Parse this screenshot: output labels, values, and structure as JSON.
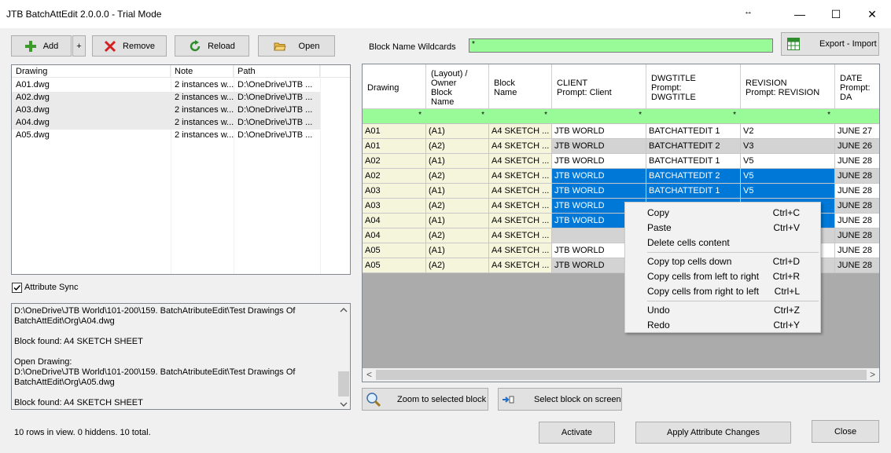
{
  "window": {
    "title": "JTB BatchAttEdit 2.0.0.0 - Trial Mode",
    "resize_glyph": "↔",
    "minimize": "—",
    "maximize": "☐",
    "close": "✕"
  },
  "toolbar": {
    "add": "Add",
    "plus": "+",
    "remove": "Remove",
    "reload": "Reload",
    "open": "Open"
  },
  "wildcards": {
    "label": "Block Name Wildcards",
    "value": "*"
  },
  "export_import": "Export - Import",
  "drawings": {
    "columns": [
      "Drawing",
      "Note",
      "Path"
    ],
    "rows": [
      {
        "drawing": "A01.dwg",
        "note": "2 instances w...",
        "path": "D:\\OneDrive\\JTB ..."
      },
      {
        "drawing": "A02.dwg",
        "note": "2 instances w...",
        "path": "D:\\OneDrive\\JTB ..."
      },
      {
        "drawing": "A03.dwg",
        "note": "2 instances w...",
        "path": "D:\\OneDrive\\JTB ..."
      },
      {
        "drawing": "A04.dwg",
        "note": "2 instances w...",
        "path": "D:\\OneDrive\\JTB ..."
      },
      {
        "drawing": "A05.dwg",
        "note": "2 instances w...",
        "path": "D:\\OneDrive\\JTB ..."
      }
    ]
  },
  "attribute_sync": {
    "label": "Attribute Sync",
    "checked": true
  },
  "log": "D:\\OneDrive\\JTB World\\101-200\\159. BatchAtributeEdit\\Test Drawings Of BatchAttEdit\\Org\\A04.dwg\n\nBlock found: A4 SKETCH SHEET\n\nOpen Drawing:\nD:\\OneDrive\\JTB World\\101-200\\159. BatchAtributeEdit\\Test Drawings Of BatchAttEdit\\Org\\A05.dwg\n\nBlock found: A4 SKETCH SHEET",
  "grid": {
    "headers": [
      "Drawing",
      "(Layout) /\nOwner\nBlock\nName",
      "Block\nName",
      "CLIENT\nPrompt: Client",
      "DWGTITLE\nPrompt:\nDWGTITLE",
      "REVISION\nPrompt: REVISION",
      "DATE\nPrompt: DA"
    ],
    "filter": [
      "*",
      "*",
      "*",
      "*",
      "*",
      "*",
      ""
    ],
    "rows": [
      [
        "A01",
        "(A1)",
        "A4 SKETCH ...",
        "JTB WORLD",
        "BATCHATTEDIT 1",
        "V2",
        "JUNE 27"
      ],
      [
        "A01",
        "(A2)",
        "A4 SKETCH ...",
        "JTB WORLD",
        "BATCHATTEDIT 2",
        "V3",
        "JUNE 26"
      ],
      [
        "A02",
        "(A1)",
        "A4 SKETCH ...",
        "JTB WORLD",
        "BATCHATTEDIT 1",
        "V5",
        "JUNE 28"
      ],
      [
        "A02",
        "(A2)",
        "A4 SKETCH ...",
        "JTB WORLD",
        "BATCHATTEDIT 2",
        "V5",
        "JUNE 28"
      ],
      [
        "A03",
        "(A1)",
        "A4 SKETCH ...",
        "JTB WORLD",
        "BATCHATTEDIT 1",
        "V5",
        "JUNE 28"
      ],
      [
        "A03",
        "(A2)",
        "A4 SKETCH ...",
        "JTB WORLD",
        "",
        "",
        "JUNE 28"
      ],
      [
        "A04",
        "(A1)",
        "A4 SKETCH ...",
        "JTB WORLD",
        "",
        "",
        "JUNE 28"
      ],
      [
        "A04",
        "(A2)",
        "A4 SKETCH ...",
        "",
        "",
        "",
        "JUNE 28"
      ],
      [
        "A05",
        "(A1)",
        "A4 SKETCH ...",
        "JTB WORLD",
        "",
        "",
        "JUNE 28"
      ],
      [
        "A05",
        "(A2)",
        "A4 SKETCH ...",
        "JTB WORLD",
        "",
        "",
        "JUNE 28"
      ]
    ],
    "scroll_left": "<",
    "scroll_right": ">"
  },
  "context_menu": [
    {
      "label": "Copy",
      "shortcut": "Ctrl+C"
    },
    {
      "label": "Paste",
      "shortcut": "Ctrl+V"
    },
    {
      "label": "Delete cells content",
      "shortcut": ""
    },
    {
      "label": "Copy top cells down",
      "shortcut": "Ctrl+D"
    },
    {
      "label": "Copy cells from left to right",
      "shortcut": "Ctrl+R"
    },
    {
      "label": "Copy cells from right to left",
      "shortcut": "Ctrl+L"
    },
    {
      "label": "Undo",
      "shortcut": "Ctrl+Z"
    },
    {
      "label": "Redo",
      "shortcut": "Ctrl+Y"
    }
  ],
  "zoom_button": "Zoom to selected block",
  "select_button": "Select block on screen",
  "activate": "Activate",
  "apply": "Apply Attribute Changes",
  "close_button": "Close",
  "status": "10 rows in view. 0 hiddens. 10 total.",
  "colors": {
    "filter_green": "#98fb98",
    "key_yellow": "#f5f5dc",
    "selection_blue": "#0078d7",
    "grid_gray": "#ababab"
  }
}
